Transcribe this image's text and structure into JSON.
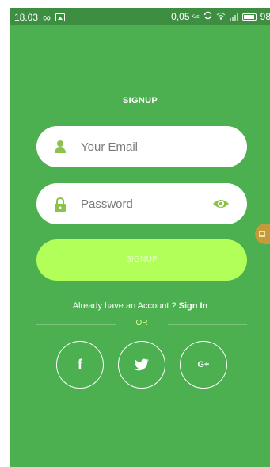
{
  "status_bar": {
    "time": "18.03",
    "infinity": "∞",
    "data_rate": "0,05",
    "data_rate_unit": "K/s",
    "battery": "98"
  },
  "title": "SIGNUP",
  "email_field": {
    "placeholder": "Your Email",
    "value": ""
  },
  "password_field": {
    "placeholder": "Password",
    "value": ""
  },
  "signup_button": {
    "label": "SIGNUP"
  },
  "account_prompt": {
    "text": "Already have an Account ? ",
    "link": "Sign In"
  },
  "divider": {
    "label": "OR"
  },
  "social": {
    "facebook_label": "f",
    "google_label": "G+"
  },
  "colors": {
    "background": "#4caf50",
    "status_bar": "#3e8e41",
    "accent": "#b2ff59",
    "icon_green": "#8bc34a",
    "white": "#ffffff"
  },
  "icons": [
    "user-icon",
    "lock-icon",
    "eye-icon",
    "facebook-icon",
    "twitter-icon",
    "google-plus-icon"
  ]
}
